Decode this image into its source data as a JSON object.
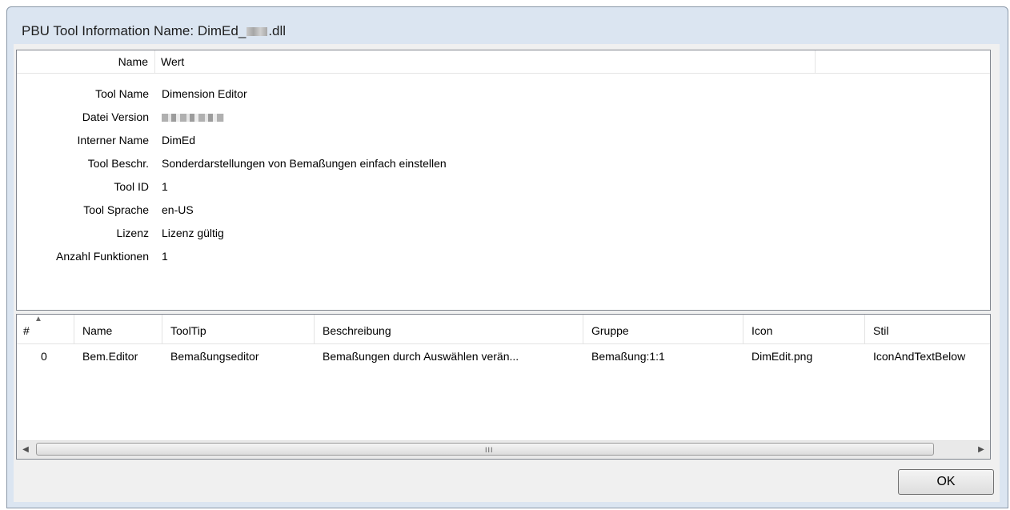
{
  "window": {
    "title_prefix": "PBU Tool Information Name: DimEd_",
    "title_suffix": ".dll"
  },
  "properties": {
    "header": {
      "name": "Name",
      "value": "Wert"
    },
    "rows": [
      {
        "key": "Tool Name",
        "value": "Dimension Editor"
      },
      {
        "key": "Datei Version",
        "value": ""
      },
      {
        "key": "Interner Name",
        "value": "DimEd"
      },
      {
        "key": "Tool Beschr.",
        "value": "Sonderdarstellungen von Bemaßungen einfach einstellen"
      },
      {
        "key": "Tool ID",
        "value": "1"
      },
      {
        "key": "Tool Sprache",
        "value": "en-US"
      },
      {
        "key": "Lizenz",
        "value": "Lizenz gültig"
      },
      {
        "key": "Anzahl Funktionen",
        "value": "1"
      }
    ]
  },
  "functions": {
    "columns": [
      "#",
      "Name",
      "ToolTip",
      "Beschreibung",
      "Gruppe",
      "Icon",
      "Stil"
    ],
    "rows": [
      [
        "0",
        "Bem.Editor",
        "Bemaßungseditor",
        "Bemaßungen durch Auswählen verän...",
        "Bemaßung:1:1",
        "DimEdit.png",
        "IconAndTextBelow"
      ]
    ],
    "scrollbar_grip": "III"
  },
  "buttons": {
    "ok": "OK"
  },
  "colors": {
    "window_frame": "#dbe5f1",
    "client": "#f0f0f0",
    "panel_border": "#828790"
  }
}
